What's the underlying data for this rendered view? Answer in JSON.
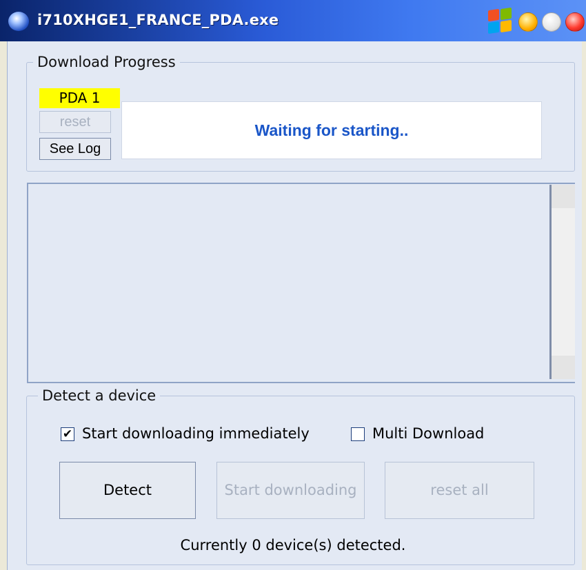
{
  "window": {
    "title": "i710XHGE1_FRANCE_PDA.exe",
    "title_color": "#FFFFFF",
    "titlebar_color": "#2A5BD7"
  },
  "progress_group": {
    "label": "Download Progress",
    "pda_label": "PDA 1",
    "pda_label_bg": "#FFFF00",
    "reset_label": "reset",
    "see_log_label": "See Log",
    "status_text": "Waiting for starting..",
    "status_color": "#1A56C8"
  },
  "detect_group": {
    "label": "Detect a device",
    "start_immediately_label": "Start downloading immediately",
    "start_immediately_checked": true,
    "multi_download_label": "Multi Download",
    "multi_download_checked": false,
    "detect_label": "Detect",
    "start_downloading_label": "Start downloading",
    "reset_all_label": "reset all",
    "footer": "Currently 0 device(s) detected."
  },
  "icons": {
    "app": "globe-app-icon",
    "windows_logo": "windows-logo-icon",
    "minimize": "minimize-icon",
    "maximize": "maximize-icon",
    "close": "close-icon",
    "checkmark": "check-icon"
  }
}
